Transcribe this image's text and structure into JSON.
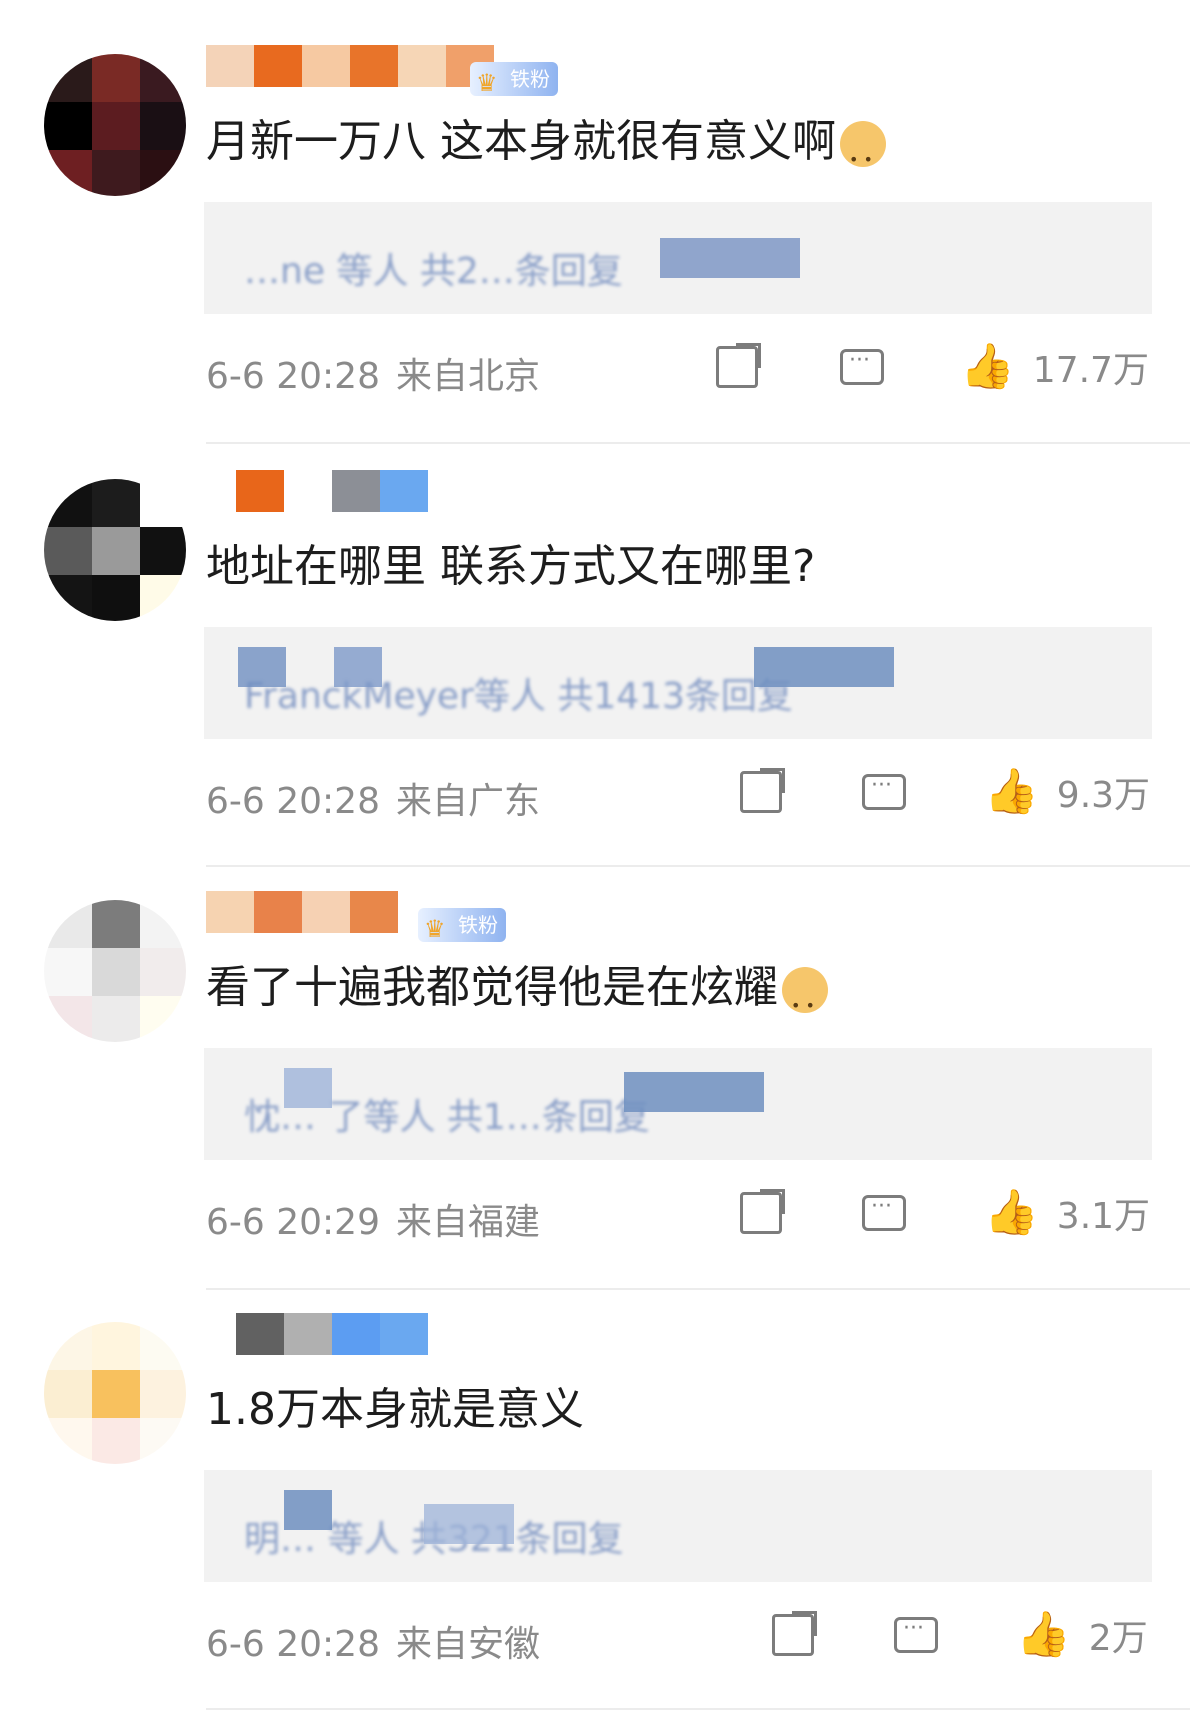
{
  "comments": [
    {
      "badge": "铁粉",
      "text": "月新一万八 这本身就很有意义啊",
      "reply_preview": "…ne 等人 共2…条回复",
      "timestamp": "6-6 20:28",
      "location": "来自北京",
      "likes": "17.7万",
      "avatar_colors": [
        "#2a1a1a",
        "#7a2a25",
        "#3a1a20",
        "#000000",
        "#5c1c20",
        "#1a0f14",
        "#6e1f22",
        "#3e1a1e",
        "#2b0f12"
      ],
      "name_colors": [
        "#f4d3b8",
        "#e86a1f",
        "#f6c9a2",
        "#e8742a",
        "#f6d6b6",
        "#f0a06a"
      ]
    },
    {
      "badge": "",
      "text": "地址在哪里 联系方式又在哪里?",
      "reply_preview": "FranckMeyer等人 共1413条回复",
      "timestamp": "6-6 20:28",
      "location": "来自广东",
      "likes": "9.3万",
      "avatar_colors": [
        "#111111",
        "#1c1c1c",
        "#ffffff",
        "#5a5a5a",
        "#9a9a9a",
        "#111111",
        "#141414",
        "#0f0f0f",
        "#fffbe8"
      ],
      "name_colors": [
        "#e8661a",
        "#8c8f96",
        "#6aa8f0"
      ]
    },
    {
      "badge": "铁粉",
      "text": "看了十遍我都觉得他是在炫耀",
      "reply_preview": "忱… 了等人 共1…条回复",
      "timestamp": "6-6 20:29",
      "location": "来自福建",
      "likes": "3.1万",
      "avatar_colors": [
        "#e9e9e9",
        "#7c7c7c",
        "#f3f3f3",
        "#f7f7f7",
        "#d9d9d9",
        "#f1ecec",
        "#f3e6e8",
        "#ecebeb",
        "#fffdf0"
      ],
      "name_colors": [
        "#f6d3b1",
        "#e8824a",
        "#f6d1b3",
        "#e8874a"
      ]
    },
    {
      "badge": "",
      "text": "1.8万本身就是意义",
      "reply_preview": "明… 等人 共321条回复",
      "timestamp": "6-6 20:28",
      "location": "来自安徽",
      "likes": "2万",
      "avatar_colors": [
        "#fdf6e6",
        "#fff5de",
        "#fdfbf2",
        "#fbeed2",
        "#f8c15e",
        "#fdf2df",
        "#fff8ee",
        "#fbe9e5",
        "#fdfaf4"
      ],
      "name_colors": [
        "#616161",
        "#b0b0b0",
        "#5c9df2",
        "#6aa8f0"
      ]
    }
  ]
}
